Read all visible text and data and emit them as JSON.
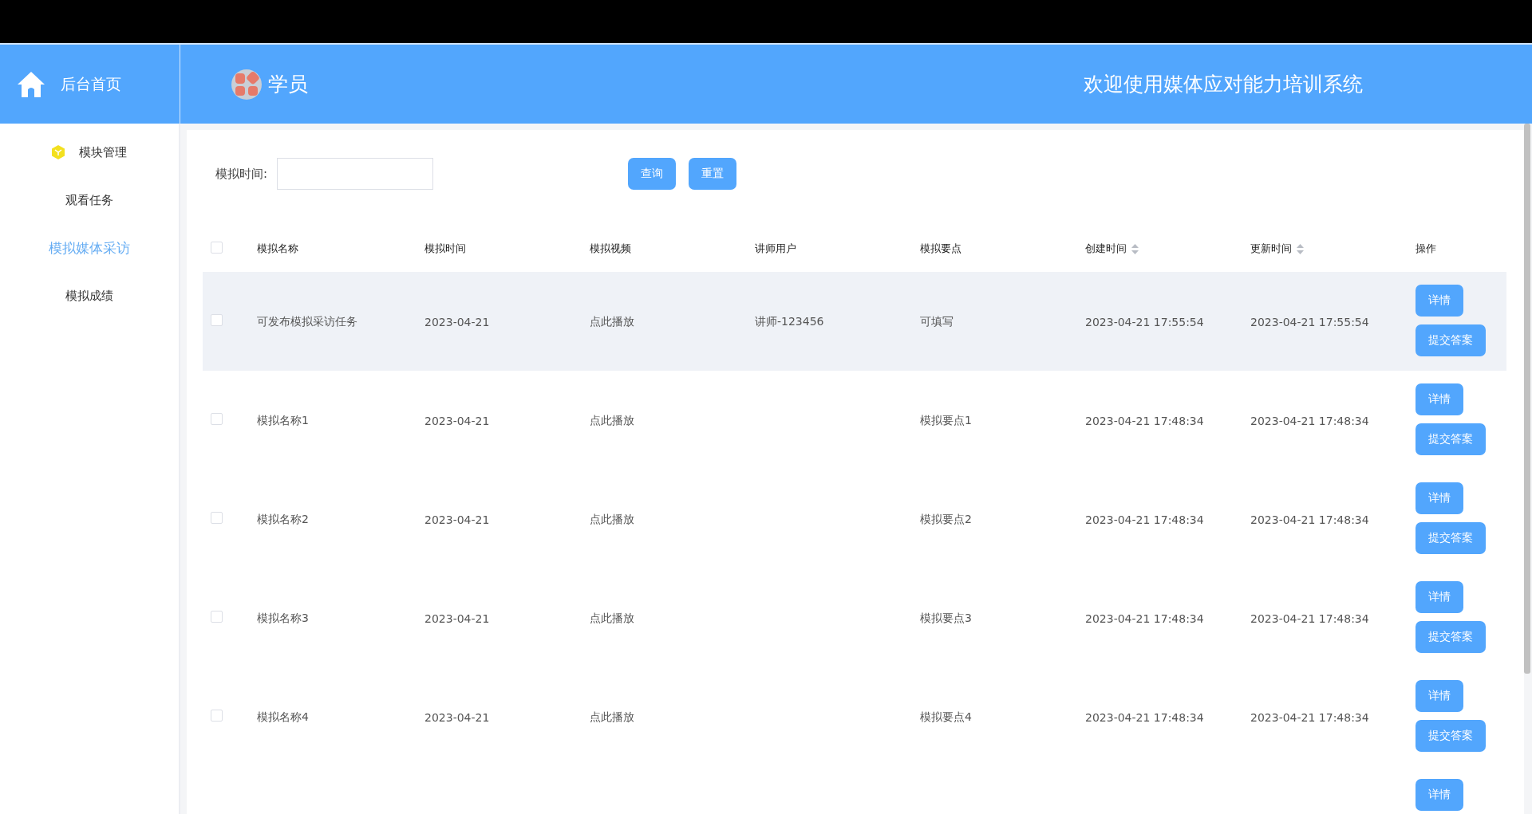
{
  "header": {
    "home_label": "后台首页",
    "role": "学员",
    "welcome": "欢迎使用媒体应对能力培训系统"
  },
  "sidebar": {
    "items": [
      {
        "label": "模块管理",
        "kind": "group",
        "selected": false
      },
      {
        "label": "观看任务",
        "kind": "link",
        "selected": false
      },
      {
        "label": "模拟媒体采访",
        "kind": "link",
        "selected": true
      },
      {
        "label": "模拟成绩",
        "kind": "link",
        "selected": false
      }
    ]
  },
  "filter": {
    "label": "模拟时间:",
    "buttons": [
      "查询",
      "重置"
    ]
  },
  "table": {
    "header_checked": false,
    "columns": [
      {
        "label": "模拟名称",
        "sortable": false
      },
      {
        "label": "模拟时间",
        "sortable": false
      },
      {
        "label": "模拟视频",
        "sortable": false
      },
      {
        "label": "讲师用户",
        "sortable": false
      },
      {
        "label": "模拟要点",
        "sortable": false
      },
      {
        "label": "创建时间",
        "sortable": true
      },
      {
        "label": "更新时间",
        "sortable": true
      },
      {
        "label": "操作",
        "sortable": false
      }
    ],
    "rows": [
      {
        "checked": false,
        "highlighted": true,
        "cells": [
          "可发布模拟采访任务",
          "2023-04-21",
          "点此播放",
          "讲师-123456",
          "可填写",
          "2023-04-21 17:55:54",
          "2023-04-21 17:55:54"
        ],
        "actions": [
          "详情",
          "提交答案"
        ]
      },
      {
        "checked": false,
        "highlighted": false,
        "cells": [
          "模拟名称1",
          "2023-04-21",
          "点此播放",
          "",
          "模拟要点1",
          "2023-04-21 17:48:34",
          "2023-04-21 17:48:34"
        ],
        "actions": [
          "详情",
          "提交答案"
        ]
      },
      {
        "checked": false,
        "highlighted": false,
        "cells": [
          "模拟名称2",
          "2023-04-21",
          "点此播放",
          "",
          "模拟要点2",
          "2023-04-21 17:48:34",
          "2023-04-21 17:48:34"
        ],
        "actions": [
          "详情",
          "提交答案"
        ]
      },
      {
        "checked": false,
        "highlighted": false,
        "cells": [
          "模拟名称3",
          "2023-04-21",
          "点此播放",
          "",
          "模拟要点3",
          "2023-04-21 17:48:34",
          "2023-04-21 17:48:34"
        ],
        "actions": [
          "详情",
          "提交答案"
        ]
      },
      {
        "checked": false,
        "highlighted": false,
        "cells": [
          "模拟名称4",
          "2023-04-21",
          "点此播放",
          "",
          "模拟要点4",
          "2023-04-21 17:48:34",
          "2023-04-21 17:48:34"
        ],
        "actions": [
          "详情",
          "提交答案"
        ]
      },
      {
        "actions": [
          "详情"
        ]
      }
    ]
  }
}
